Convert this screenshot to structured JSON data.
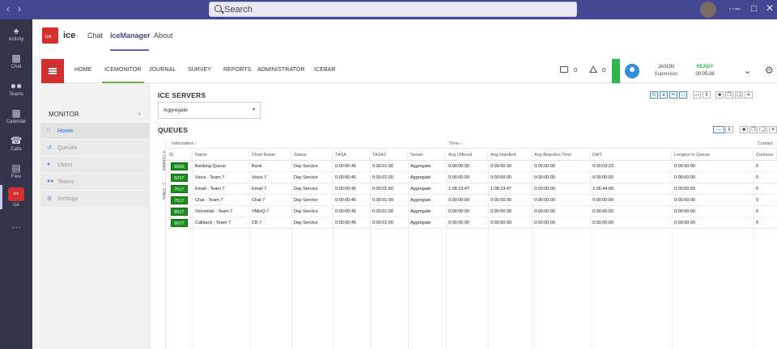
{
  "titlebar": {
    "search_placeholder": "Search"
  },
  "rail": [
    {
      "label": "Activity",
      "icon": "bell-icon"
    },
    {
      "label": "Chat",
      "icon": "chat-icon"
    },
    {
      "label": "Teams",
      "icon": "teams-icon"
    },
    {
      "label": "Calendar",
      "icon": "calendar-icon"
    },
    {
      "label": "Calls",
      "icon": "phone-icon"
    },
    {
      "label": "Files",
      "icon": "file-icon"
    },
    {
      "label": "ice",
      "icon": "ice-app-icon"
    }
  ],
  "app": {
    "logo_text": "ice",
    "name": "ice",
    "tabs": [
      "Chat",
      "iceManager",
      "About"
    ],
    "active_tab": "iceManager"
  },
  "topnav": {
    "items": [
      "HOME",
      "ICEMONITOR",
      "JOURNAL",
      "SURVEY",
      "REPORTS",
      "ADMINISTRATOR",
      "ICEBAR"
    ],
    "active": "ICEMONITOR",
    "chat_count": "0",
    "alert_count": "0"
  },
  "agent": {
    "name": "JASON",
    "role": "Supervisor",
    "state": "READY",
    "timer": "00:05:38",
    "state_color": "#2db84d"
  },
  "sidebar": {
    "title": "MONITOR",
    "items": [
      {
        "label": "Home",
        "icon": "home-icon",
        "active": true
      },
      {
        "label": "Queues",
        "icon": "history-icon",
        "active": false
      },
      {
        "label": "Users",
        "icon": "user-icon",
        "active": false
      },
      {
        "label": "Teams",
        "icon": "team-icon",
        "active": false
      },
      {
        "label": "Settings",
        "icon": "settings-icon",
        "active": false
      }
    ]
  },
  "servers": {
    "title": "ICE SERVERS",
    "selected": "Aggregate"
  },
  "queues": {
    "title": "QUEUES",
    "vertical_tabs": [
      "Columns",
      "Filters"
    ],
    "groups": [
      "Information",
      "Time",
      "Contact"
    ],
    "columns": [
      "ID",
      "Name",
      "Short Name",
      "Status",
      "TASA",
      "TASA2",
      "Server",
      "Avg Offered",
      "Avg Handled",
      "Avg Abandon Time",
      "EWT",
      "Longest In Queue",
      "Contacts"
    ],
    "rows": [
      {
        "id": "6000",
        "name": "Banking Queue",
        "short": "Bank",
        "status": "Day Service",
        "tasa": "0:00:00:45",
        "tasa2": "0:00:01:00",
        "server": "Aggregate",
        "avg_offered": "0:00:00:00",
        "avg_handled": "0:00:00:00",
        "avg_abandon": "0:00:00:00",
        "ewt": "0:00:03:23",
        "longest": "0:00:00:00",
        "contacts": "0"
      },
      {
        "id": "6017",
        "name": "Voice - Team 7",
        "short": "Voice-7",
        "status": "Day Service",
        "tasa": "0:00:00:45",
        "tasa2": "0:00:01:00",
        "server": "Aggregate",
        "avg_offered": "0:00:00:00",
        "avg_handled": "0:00:00:00",
        "avg_abandon": "0:00:00:00",
        "ewt": "0:00:00:00",
        "longest": "0:00:00:00",
        "contacts": "0"
      },
      {
        "id": "7017",
        "name": "Email - Team 7",
        "short": "Email 7",
        "status": "Day Service",
        "tasa": "0:00:00:45",
        "tasa2": "0:00:01:00",
        "server": "Aggregate",
        "avg_offered": "1:08:19:47",
        "avg_handled": "1:08:19:47",
        "avg_abandon": "0:00:00:00",
        "ewt": "1:06:44:09",
        "longest": "0:00:00:00",
        "contacts": "0"
      },
      {
        "id": "7517",
        "name": "Chat - Team 7",
        "short": "Chat 7",
        "status": "Day Service",
        "tasa": "0:00:00:45",
        "tasa2": "0:00:01:00",
        "server": "Aggregate",
        "avg_offered": "0:00:00:00",
        "avg_handled": "0:00:00:00",
        "avg_abandon": "0:00:00:00",
        "ewt": "0:00:00:00",
        "longest": "0:00:00:00",
        "contacts": "0"
      },
      {
        "id": "8017",
        "name": "Voicemail - Team 7",
        "short": "VMixQ-7",
        "status": "Day Service",
        "tasa": "0:00:00:45",
        "tasa2": "0:00:01:00",
        "server": "Aggregate",
        "avg_offered": "0:00:00:00",
        "avg_handled": "0:00:00:00",
        "avg_abandon": "0:00:00:00",
        "ewt": "0:00:00:00",
        "longest": "0:00:00:00",
        "contacts": "0"
      },
      {
        "id": "9017",
        "name": "Callback - Team 7",
        "short": "CB 7",
        "status": "Day Service",
        "tasa": "0:00:00:45",
        "tasa2": "0:00:01:00",
        "server": "Aggregate",
        "avg_offered": "0:00:00:00",
        "avg_handled": "0:00:00:00",
        "avg_abandon": "0:00:00:00",
        "ewt": "0:00:00:00",
        "longest": "0:00:00:00",
        "contacts": "0"
      }
    ],
    "id_badge_color": "#1a8f1a"
  }
}
